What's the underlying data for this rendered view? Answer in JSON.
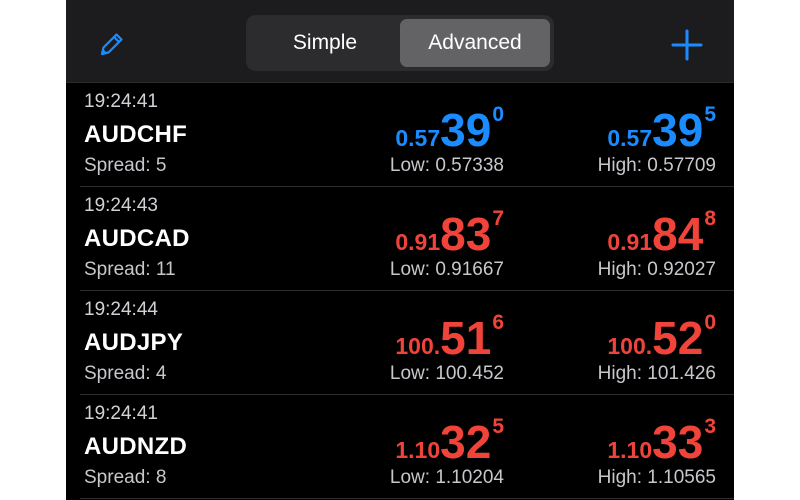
{
  "colors": {
    "up": "#1a8cff",
    "down": "#f0443a",
    "accent": "#1a8cff"
  },
  "header": {
    "edit_icon": "pencil-icon",
    "add_icon": "plus-icon",
    "tabs": [
      {
        "label": "Simple",
        "active": false
      },
      {
        "label": "Advanced",
        "active": true
      }
    ]
  },
  "quotes": [
    {
      "time": "19:24:41",
      "symbol": "AUDCHF",
      "spread": "Spread: 5",
      "direction": "up",
      "bid": {
        "small": "0.57",
        "big": "39",
        "sup": "0"
      },
      "ask": {
        "small": "0.57",
        "big": "39",
        "sup": "5"
      },
      "low": "Low: 0.57338",
      "high": "High: 0.57709"
    },
    {
      "time": "19:24:43",
      "symbol": "AUDCAD",
      "spread": "Spread: 11",
      "direction": "down",
      "bid": {
        "small": "0.91",
        "big": "83",
        "sup": "7"
      },
      "ask": {
        "small": "0.91",
        "big": "84",
        "sup": "8"
      },
      "low": "Low: 0.91667",
      "high": "High: 0.92027"
    },
    {
      "time": "19:24:44",
      "symbol": "AUDJPY",
      "spread": "Spread: 4",
      "direction": "down",
      "bid": {
        "small": "100.",
        "big": "51",
        "sup": "6"
      },
      "ask": {
        "small": "100.",
        "big": "52",
        "sup": "0"
      },
      "low": "Low: 100.452",
      "high": "High: 101.426"
    },
    {
      "time": "19:24:41",
      "symbol": "AUDNZD",
      "spread": "Spread: 8",
      "direction": "down",
      "bid": {
        "small": "1.10",
        "big": "32",
        "sup": "5"
      },
      "ask": {
        "small": "1.10",
        "big": "33",
        "sup": "3"
      },
      "low": "Low: 1.10204",
      "high": "High: 1.10565"
    }
  ]
}
